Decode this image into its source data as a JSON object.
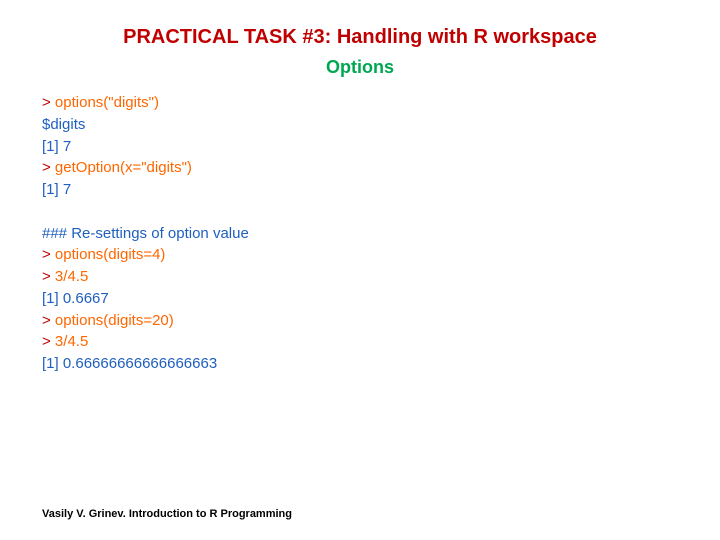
{
  "title": "PRACTICAL TASK #3: Handling with R workspace",
  "subtitle": "Options",
  "code": {
    "l1_prompt": ">",
    "l1_cmd": " options(\"digits\")",
    "l2": "$digits",
    "l3": "[1] 7",
    "l4_prompt": ">",
    "l4_cmd": " getOption(x=\"digits\")",
    "l5": "[1] 7",
    "l6": "### Re-settings of option value",
    "l7_prompt": ">",
    "l7_cmd": " options(digits=4)",
    "l8_prompt": ">",
    "l8_cmd": " 3/4.5",
    "l9": "[1] 0.6667",
    "l10_prompt": ">",
    "l10_cmd": " options(digits=20)",
    "l11_prompt": ">",
    "l11_cmd": " 3/4.5",
    "l12": "[1] 0.66666666666666663"
  },
  "footer": "Vasily V. Grinev. Introduction to R Programming"
}
